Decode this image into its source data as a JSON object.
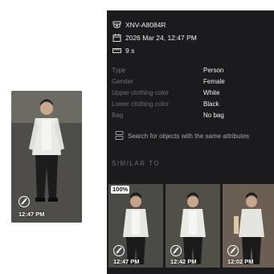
{
  "event": {
    "camera_name": "XNV-A8084R",
    "datetime": "2026 Mar 24, 12:47 PM",
    "duration": "9 s"
  },
  "thumbnail": {
    "time": "12:47 PM"
  },
  "attributes": [
    {
      "label": "Type",
      "value": "Person"
    },
    {
      "label": "Gender",
      "value": "Female"
    },
    {
      "label": "Upper clothing color",
      "value": "White"
    },
    {
      "label": "Lower clothing color",
      "value": "Black"
    },
    {
      "label": "Bag",
      "value": "No bag"
    }
  ],
  "search_action": "Search for objects with the same attributes",
  "similar": {
    "title": "SIMILAR TO",
    "items": [
      {
        "time": "12:47 PM",
        "match": "100%"
      },
      {
        "time": "12:42 PM"
      },
      {
        "time": "12:02 PM"
      }
    ]
  },
  "colors": {
    "panel_bg": "#1b1b1d",
    "label_text": "#6f6f73",
    "value_text": "#f2f2f2"
  }
}
